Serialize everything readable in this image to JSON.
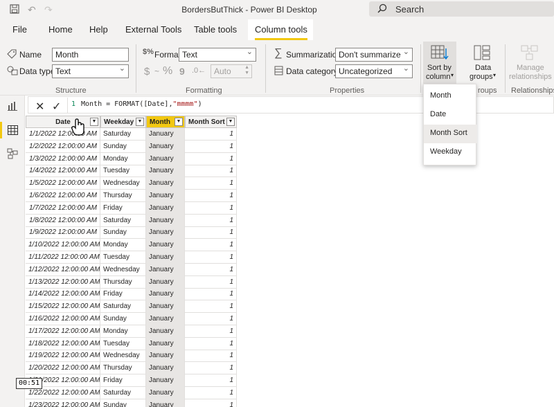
{
  "title_bar": {
    "app_title": "BordersButThick - Power BI Desktop",
    "search_label": "Search"
  },
  "tabs": [
    {
      "label": "File"
    },
    {
      "label": "Home"
    },
    {
      "label": "Help"
    },
    {
      "label": "External Tools"
    },
    {
      "label": "Table tools"
    },
    {
      "label": "Column tools",
      "active": true
    }
  ],
  "ribbon": {
    "structure": {
      "name_label": "Name",
      "name_value": "Month",
      "datatype_label": "Data type",
      "datatype_value": "Text",
      "group": "Structure"
    },
    "formatting": {
      "format_label": "Format",
      "format_value": "Text",
      "currency_symbol": "$",
      "separator_symbol": "~",
      "percent_symbol": "%",
      "comma_symbol": "9",
      "decimal_value": "Auto",
      "group": "Formatting"
    },
    "properties": {
      "summarization_label": "Summarization",
      "summarization_value": "Don't summarize",
      "category_label": "Data category",
      "category_value": "Uncategorized",
      "group": "Properties"
    },
    "sort": {
      "label_line1": "Sort by",
      "label_line2": "column"
    },
    "groups": {
      "label_line1": "Data",
      "label_line2": "groups",
      "group": "roups"
    },
    "relationships": {
      "label_line1": "Manage",
      "label_line2": "relationships",
      "group": "Relationships"
    }
  },
  "formula": {
    "line_number": "1",
    "text_before": "Month = FORMAT(",
    "text_ref": "[Date]",
    "text_sep": ",",
    "text_str": "\"mmmm\"",
    "text_after": ")"
  },
  "sort_dropdown": {
    "items": [
      "Month",
      "Date",
      "Month Sort",
      "Weekday"
    ],
    "selected": "Month Sort"
  },
  "grid": {
    "columns": [
      "Date",
      "Weekday",
      "Month",
      "Month Sort"
    ],
    "selected_column": "Month",
    "rows": [
      [
        "1/1/2022 12:00:00 AM",
        "Saturday",
        "January",
        "1"
      ],
      [
        "1/2/2022 12:00:00 AM",
        "Sunday",
        "January",
        "1"
      ],
      [
        "1/3/2022 12:00:00 AM",
        "Monday",
        "January",
        "1"
      ],
      [
        "1/4/2022 12:00:00 AM",
        "Tuesday",
        "January",
        "1"
      ],
      [
        "1/5/2022 12:00:00 AM",
        "Wednesday",
        "January",
        "1"
      ],
      [
        "1/6/2022 12:00:00 AM",
        "Thursday",
        "January",
        "1"
      ],
      [
        "1/7/2022 12:00:00 AM",
        "Friday",
        "January",
        "1"
      ],
      [
        "1/8/2022 12:00:00 AM",
        "Saturday",
        "January",
        "1"
      ],
      [
        "1/9/2022 12:00:00 AM",
        "Sunday",
        "January",
        "1"
      ],
      [
        "1/10/2022 12:00:00 AM",
        "Monday",
        "January",
        "1"
      ],
      [
        "1/11/2022 12:00:00 AM",
        "Tuesday",
        "January",
        "1"
      ],
      [
        "1/12/2022 12:00:00 AM",
        "Wednesday",
        "January",
        "1"
      ],
      [
        "1/13/2022 12:00:00 AM",
        "Thursday",
        "January",
        "1"
      ],
      [
        "1/14/2022 12:00:00 AM",
        "Friday",
        "January",
        "1"
      ],
      [
        "1/15/2022 12:00:00 AM",
        "Saturday",
        "January",
        "1"
      ],
      [
        "1/16/2022 12:00:00 AM",
        "Sunday",
        "January",
        "1"
      ],
      [
        "1/17/2022 12:00:00 AM",
        "Monday",
        "January",
        "1"
      ],
      [
        "1/18/2022 12:00:00 AM",
        "Tuesday",
        "January",
        "1"
      ],
      [
        "1/19/2022 12:00:00 AM",
        "Wednesday",
        "January",
        "1"
      ],
      [
        "1/20/2022 12:00:00 AM",
        "Thursday",
        "January",
        "1"
      ],
      [
        "1/21/2022 12:00:00 AM",
        "Friday",
        "January",
        "1"
      ],
      [
        "1/22/2022 12:00:00 AM",
        "Saturday",
        "January",
        "1"
      ],
      [
        "1/23/2022 12:00:00 AM",
        "Sunday",
        "January",
        "1"
      ]
    ]
  },
  "timestamp": "00:51",
  "colors": {
    "accent": "#f2c811",
    "chrome": "#f3f2f1"
  }
}
